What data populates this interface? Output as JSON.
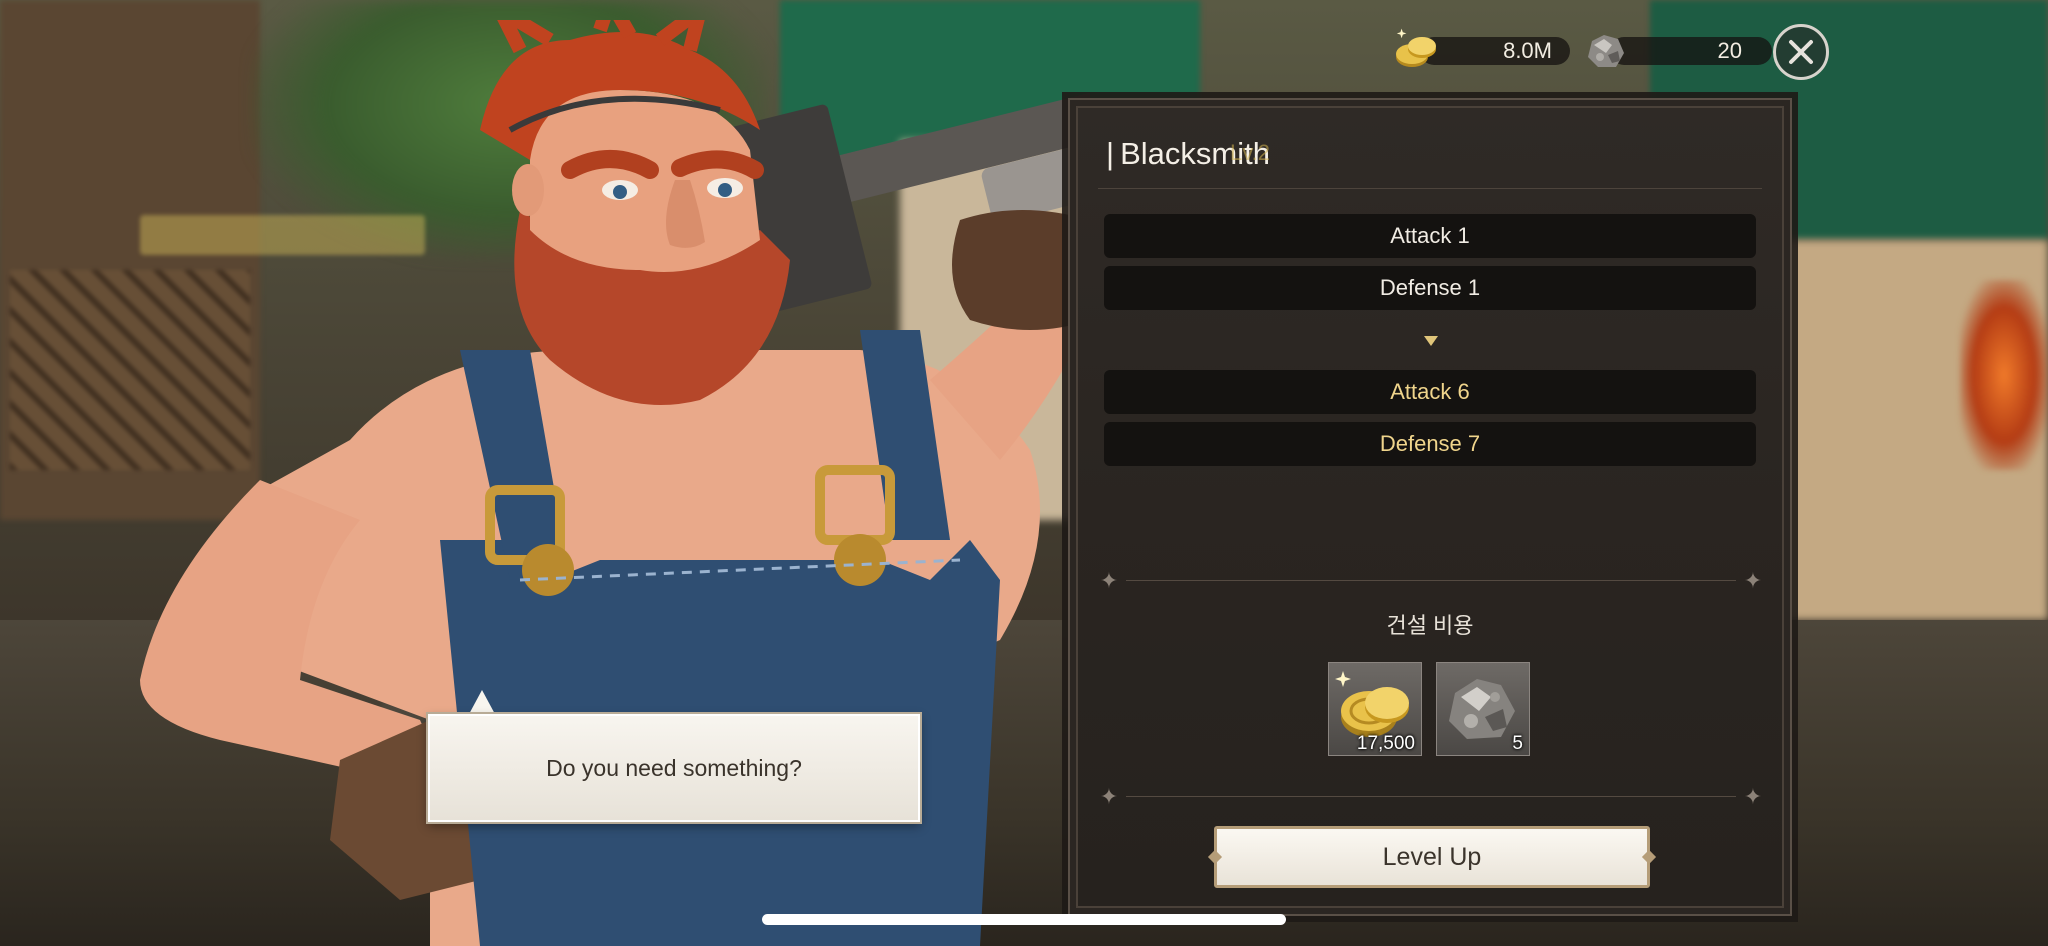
{
  "topbar": {
    "gold_amount": "8.0M",
    "ore_amount": "20"
  },
  "panel": {
    "title": "Blacksmith",
    "title_bar": "|",
    "level_ghost": "Lv.2",
    "current_stats": [
      "Attack 1",
      "Defense 1"
    ],
    "next_stats": [
      "Attack 6",
      "Defense 7"
    ],
    "cost_label": "건설 비용",
    "costs": [
      {
        "icon": "gold-coins-icon",
        "quantity": "17,500"
      },
      {
        "icon": "ore-icon",
        "quantity": "5"
      }
    ],
    "level_up_label": "Level Up"
  },
  "dialog": {
    "text": "Do you need something?"
  },
  "colors": {
    "panel_bg": "#2a2521",
    "stat_row_bg": "#141210",
    "next_stat_text": "#f0d58c",
    "button_bg": "#f3efe7",
    "button_border": "#b59d78"
  }
}
